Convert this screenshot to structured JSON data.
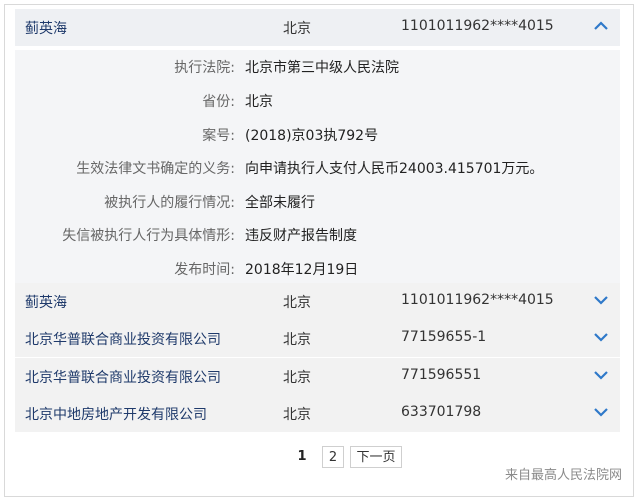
{
  "results": [
    {
      "name": "蓟英海",
      "city": "北京",
      "id": "1101011962****4015",
      "expanded": true
    },
    {
      "name": "蓟英海",
      "city": "北京",
      "id": "1101011962****4015",
      "expanded": false
    },
    {
      "name": "北京华普联合商业投资有限公司",
      "city": "北京",
      "id": "77159655-1",
      "expanded": false
    },
    {
      "name": "北京华普联合商业投资有限公司",
      "city": "北京",
      "id": "771596551",
      "expanded": false
    },
    {
      "name": "北京中地房地产开发有限公司",
      "city": "北京",
      "id": "633701798",
      "expanded": false
    }
  ],
  "details": [
    {
      "label": "执行法院:",
      "value": "北京市第三中级人民法院"
    },
    {
      "label": "省份:",
      "value": "北京"
    },
    {
      "label": "案号:",
      "value": "(2018)京03执792号"
    },
    {
      "label": "生效法律文书确定的义务:",
      "value": "向申请执行人支付人民币24003.415701万元。"
    },
    {
      "label": "被执行人的履行情况:",
      "value": "全部未履行"
    },
    {
      "label": "失信被执行人行为具体情形:",
      "value": "违反财产报告制度"
    },
    {
      "label": "发布时间:",
      "value": "2018年12月19日"
    }
  ],
  "pagination": {
    "current": "1",
    "page2": "2",
    "next": "下一页"
  },
  "watermark": "来自最高人民法院网",
  "colors": {
    "name_link": "#1f3a6b",
    "chevron": "#2f79c9",
    "row_bg": "#f2f2f2"
  },
  "icons": {
    "expanded": "chevron-up-icon",
    "collapsed": "chevron-down-icon"
  }
}
